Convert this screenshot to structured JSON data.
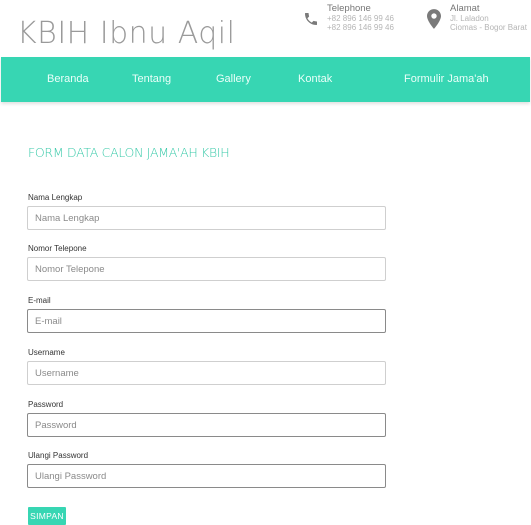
{
  "header": {
    "logo": "KBIH Ibnu Aqil",
    "phone": {
      "icon": "phone-icon",
      "title": "Telephone",
      "lines": [
        "+82 896 146 99 46",
        "+82 896 146 99 46"
      ]
    },
    "address": {
      "icon": "map-pin-icon",
      "title": "Alamat",
      "lines": [
        "Jl. Laladon",
        "Ciomas - Bogor Barat"
      ]
    }
  },
  "nav": {
    "items": [
      {
        "label": "Beranda"
      },
      {
        "label": "Tentang"
      },
      {
        "label": "Gallery"
      },
      {
        "label": "Kontak"
      },
      {
        "label": "Formulir Jama'ah"
      }
    ]
  },
  "form": {
    "title": "FORM DATA CALON JAMA'AH KBIH",
    "fields": [
      {
        "label": "Nama Lengkap",
        "placeholder": "Nama Lengkap",
        "value": ""
      },
      {
        "label": "Nomor Telepone",
        "placeholder": "Nomor Telepone",
        "value": ""
      },
      {
        "label": "E-mail",
        "placeholder": "E-mail",
        "value": ""
      },
      {
        "label": "Username",
        "placeholder": "Username",
        "value": ""
      },
      {
        "label": "Password",
        "placeholder": "Password",
        "value": ""
      },
      {
        "label": "Ulangi Password",
        "placeholder": "Ulangi Password",
        "value": ""
      }
    ],
    "submit_label": "SIMPAN"
  },
  "colors": {
    "accent": "#37d6b3",
    "title": "#37c9a8",
    "logo": "#9a9a9a",
    "icon": "#777777"
  }
}
